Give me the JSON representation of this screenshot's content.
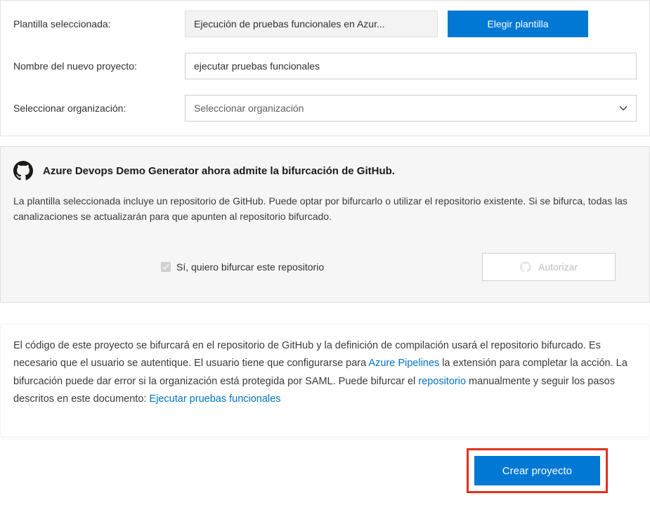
{
  "form": {
    "template_label": "Plantilla seleccionada:",
    "template_value": "Ejecución de pruebas funcionales en Azur...",
    "choose_template_btn": "Elegir plantilla",
    "project_name_label": "Nombre del nuevo proyecto:",
    "project_name_value": "ejecutar pruebas funcionales",
    "org_label": "Seleccionar organización:",
    "org_placeholder": "Seleccionar organización"
  },
  "github": {
    "title": "Azure Devops Demo Generator ahora admite la bifurcación de GitHub.",
    "body": "La plantilla seleccionada incluye un repositorio de GitHub. Puede optar por bifurcarlo o utilizar el repositorio existente. Si se bifurca, todas las canalizaciones se actualizarán para que apunten al repositorio bifurcado.",
    "checkbox_label": "Sí, quiero bifurcar este repositorio",
    "authorize_btn": "Autorizar"
  },
  "note": {
    "part1": "El código de este proyecto se bifurcará en el repositorio de GitHub y la definición de compilación usará el repositorio bifurcado. Es necesario que el usuario se autentique. El usuario tiene que configurarse para ",
    "link1": "Azure Pipelines",
    "part2": " la extensión para completar la acción. La bifurcación puede dar error si la organización está protegida por SAML. Puede bifurcar el ",
    "link2": "repositorio",
    "part3": " manualmente y seguir los pasos descritos en este documento: ",
    "link3": "Ejecutar pruebas funcionales"
  },
  "footer": {
    "create_btn": "Crear proyecto"
  }
}
